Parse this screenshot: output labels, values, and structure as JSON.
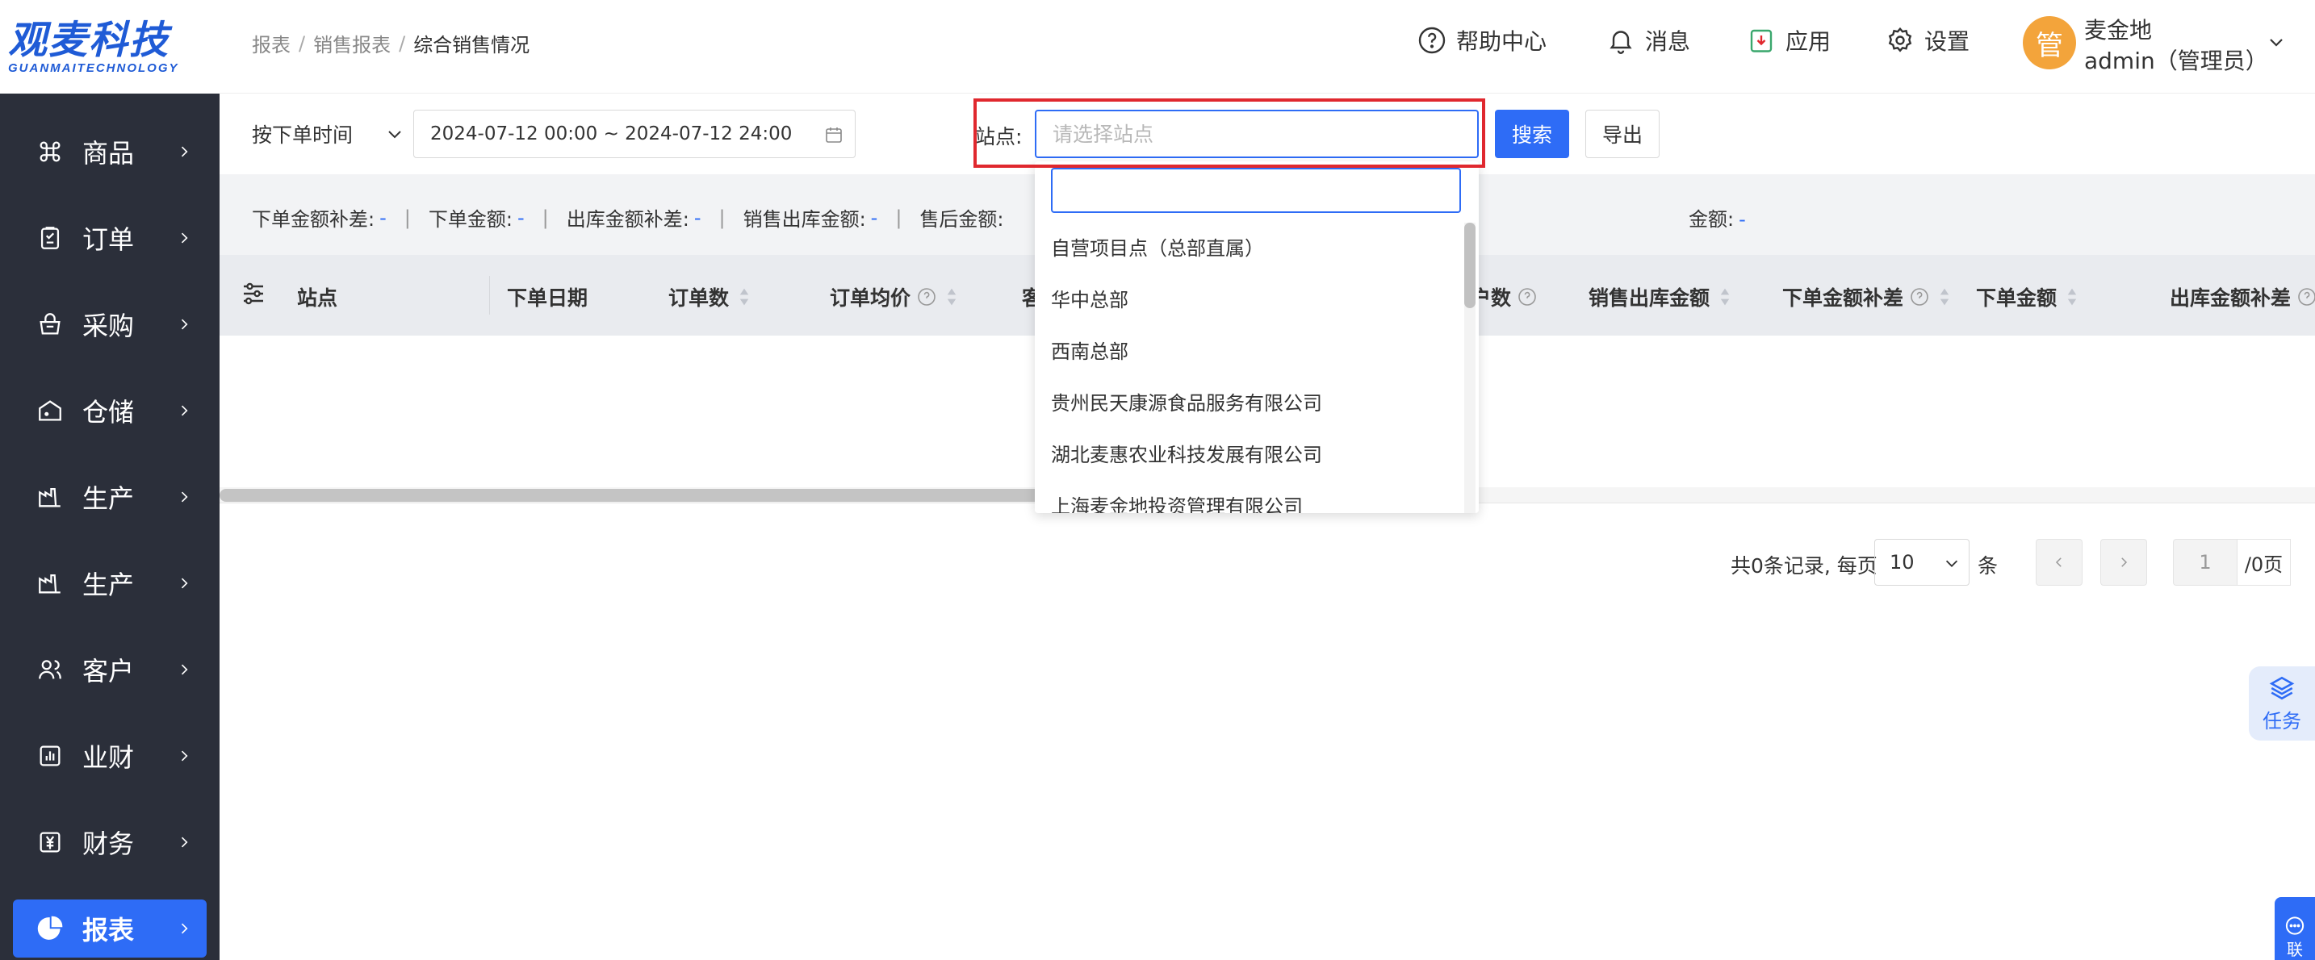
{
  "logo": {
    "cn": "观麦科技",
    "en": "GUANMAITECHNOLOGY"
  },
  "sidebar": {
    "items": [
      {
        "label": "商品",
        "icon": "command-icon"
      },
      {
        "label": "订单",
        "icon": "clipboard-icon"
      },
      {
        "label": "采购",
        "icon": "basket-icon"
      },
      {
        "label": "仓储",
        "icon": "warehouse-icon"
      },
      {
        "label": "生产",
        "icon": "factory-icon"
      },
      {
        "label": "生产",
        "icon": "factory-icon"
      },
      {
        "label": "客户",
        "icon": "users-icon"
      },
      {
        "label": "业财",
        "icon": "bar-chart-icon"
      },
      {
        "label": "财务",
        "icon": "yuan-icon"
      },
      {
        "label": "报表",
        "icon": "pie-chart-icon",
        "active": true
      }
    ]
  },
  "breadcrumb": {
    "level1": "报表",
    "level2": "销售报表",
    "current": "综合销售情况"
  },
  "header": {
    "help": "帮助中心",
    "messages": "消息",
    "apps": "应用",
    "settings": "设置",
    "user": {
      "avatar": "管",
      "name": "麦金地",
      "role": "admin（管理员）"
    }
  },
  "filter": {
    "time_type": "按下单时间",
    "date_range": "2024-07-12 00:00 ~ 2024-07-12 24:00",
    "site_label": "站点:",
    "site_placeholder": "请选择站点",
    "search_btn": "搜索",
    "export_btn": "导出"
  },
  "summary": {
    "items": [
      {
        "label": "下单金额补差:",
        "value": "-"
      },
      {
        "label": "下单金额:",
        "value": "-"
      },
      {
        "label": "出库金额补差:",
        "value": "-"
      },
      {
        "label": "销售出库金额:",
        "value": "-"
      },
      {
        "label": "售后金额:",
        "value": ""
      }
    ],
    "tail": {
      "label": "金额:",
      "value": "-"
    }
  },
  "table": {
    "columns": [
      {
        "label": "站点"
      },
      {
        "label": "下单日期"
      },
      {
        "label": "订单数",
        "sort": true
      },
      {
        "label": "订单均价",
        "help": true,
        "sort": true
      },
      {
        "label": "客"
      },
      {
        "label": "户数",
        "help": true
      },
      {
        "label": "销售出库金额",
        "sort": true
      },
      {
        "label": "下单金额补差",
        "help": true,
        "sort": true
      },
      {
        "label": "下单金额",
        "sort": true
      },
      {
        "label": "出库金额补差",
        "help": true
      }
    ]
  },
  "dropdown": {
    "options": [
      "自营项目点（总部直属）",
      "华中总部",
      "西南总部",
      "贵州民天康源食品服务有限公司",
      "湖北麦惠农业科技发展有限公司",
      "上海麦金地投资管理有限公司"
    ]
  },
  "pagination": {
    "summary": "共0条记录, 每页",
    "page_size": "10",
    "unit": "条",
    "current_page": "1",
    "total_pages": "/0页"
  },
  "floating": {
    "task": "任务",
    "chat": "联"
  },
  "colors": {
    "primary": "#2e6cf6",
    "sidebar": "#2b2f3a",
    "highlight": "#e0282e"
  }
}
